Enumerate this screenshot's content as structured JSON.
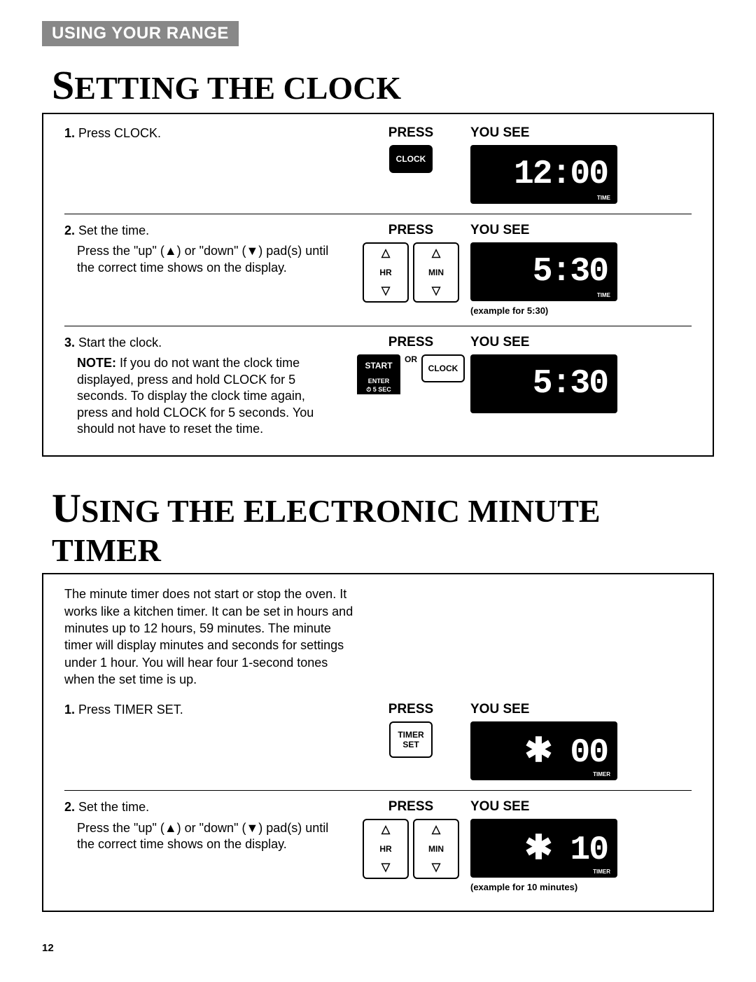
{
  "section_header": "USING YOUR RANGE",
  "headings": {
    "clock_cap": "S",
    "clock_rest": "ETTING THE CLOCK",
    "timer_cap": "U",
    "timer_rest": "SING THE ELECTRONIC MINUTE TIMER"
  },
  "labels": {
    "press": "PRESS",
    "you_see": "YOU SEE",
    "or": "OR",
    "hr": "HR",
    "min": "MIN",
    "time": "TIME",
    "timer": "TIMER",
    "enter": "ENTER",
    "hold5": "⏱ 5 SEC"
  },
  "buttons": {
    "clock": "CLOCK",
    "start": "START",
    "timer_set1": "TIMER",
    "timer_set2": "SET"
  },
  "displays": {
    "clock1": "12:00",
    "clock2": "5:30",
    "clock3": "5:30",
    "timer1": "✱ 00",
    "timer2": "✱ 10"
  },
  "notes": {
    "example_530": "(example for 5:30)",
    "example_10": "(example for 10 minutes)"
  },
  "clock_steps": {
    "s1_num": "1.",
    "s1_text": "Press CLOCK.",
    "s2_num": "2.",
    "s2_text": "Set the time.",
    "s2_sub": "Press the \"up\" (▲) or \"down\" (▼) pad(s) until the correct time shows on the display.",
    "s3_num": "3.",
    "s3_text": "Start the clock.",
    "s3_note_label": "NOTE:",
    "s3_note": " If you do not want the clock time displayed, press and hold CLOCK for 5 seconds. To display the clock time again, press and hold CLOCK for 5 seconds. You should not have to reset the time."
  },
  "timer_intro": "The minute timer does not start or stop the oven. It works like a kitchen timer. It can be set in hours and minutes up to 12 hours, 59 minutes. The minute timer will display minutes and seconds for settings under 1 hour. You will hear four 1-second tones when the set time is up.",
  "timer_steps": {
    "s1_num": "1.",
    "s1_text": "Press TIMER SET.",
    "s2_num": "2.",
    "s2_text": "Set the time.",
    "s2_sub": "Press the \"up\" (▲) or \"down\" (▼) pad(s) until the correct time shows on the display."
  },
  "page_number": "12"
}
